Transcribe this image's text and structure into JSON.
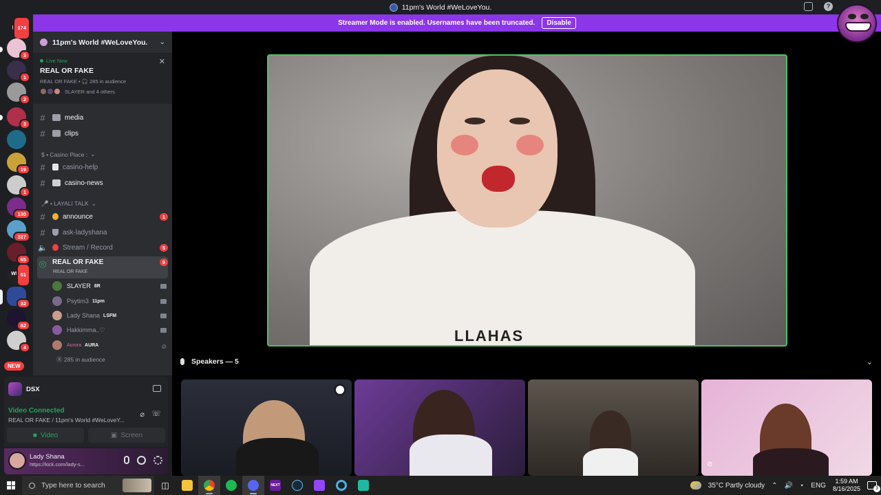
{
  "window": {
    "title": "11pm's World #WeLoveYou."
  },
  "banner": {
    "text": "Streamer Mode is enabled. Usernames have been truncated.",
    "button": "Disable"
  },
  "servers": {
    "badges": [
      "174",
      "3",
      "1",
      "2",
      "3",
      "",
      "19",
      "1",
      "130",
      "327",
      "65",
      "51",
      "32",
      "82",
      "4"
    ],
    "new_label": "NEW"
  },
  "sidebar": {
    "server_name": "11pm's World #WeLoveYou.",
    "live": {
      "status": "Live Now",
      "title": "REAL OR FAKE",
      "sub": "REAL OR FAKE • 🎧 285 in audience",
      "avatars_text": "SLAYER and 4 others"
    },
    "channels": [
      {
        "name": "media",
        "badge": ""
      },
      {
        "name": "clips",
        "badge": ""
      }
    ],
    "category_casino": "$ • Casino Place :",
    "casino": [
      {
        "name": "casino-help"
      },
      {
        "name": "casino-news"
      }
    ],
    "category_layali": "🎤 • LAYALI TALK",
    "layali": [
      {
        "name": "announce",
        "badge": "1"
      },
      {
        "name": "ask-ladyshana",
        "badge": ""
      },
      {
        "name": "Stream / Record",
        "badge": "5"
      }
    ],
    "stage": {
      "name": "REAL OR FAKE",
      "sub": "REAL OR FAKE",
      "badge": "9"
    },
    "voice_users": [
      {
        "name": "SLAYER",
        "tag": "8R"
      },
      {
        "name": "Psytim3",
        "tag": "11pm"
      },
      {
        "name": "Lady Shana",
        "tag": "LSFM"
      },
      {
        "name": "Hakkimma..♡",
        "tag": ""
      },
      {
        "name": "Aurora",
        "tag": "AURA"
      }
    ],
    "audience": "285 in audience"
  },
  "rtc": {
    "server": "DSX",
    "status": "Video Connected",
    "location": "REAL OR FAKE / 11pm's World #WeLoveY...",
    "video_label": "Video",
    "screen_label": "Screen"
  },
  "user": {
    "name": "Lady Shana",
    "status": "https://kick.com/lady-s..."
  },
  "stage": {
    "speakers_label": "Speakers — 5",
    "shirt_text": "LLAHAS"
  },
  "taskbar": {
    "search_placeholder": "Type here to search",
    "weather": "35°C  Partly cloudy",
    "lang": "ENG",
    "time": "1:59 AM",
    "date": "8/16/2025",
    "notif_count": "3"
  },
  "colors": {
    "accent": "#8b36e8",
    "live_green": "#23a55a",
    "badge_red": "#f23f42",
    "border_speaking": "#4fc464"
  }
}
